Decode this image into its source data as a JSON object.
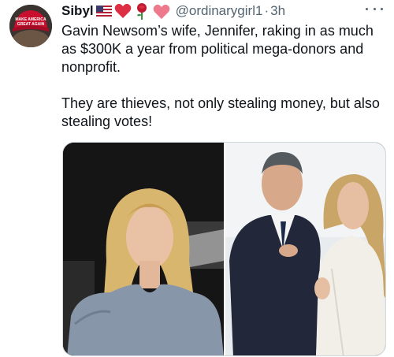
{
  "tweet": {
    "display_name": "Sibyl",
    "handle": "@ordinarygirl1",
    "separator": "·",
    "time": "3h",
    "paragraphs": [
      "Gavin Newsom’s wife, Jennifer, raking in as much as $300K a year from political mega-donors and nonprofit.",
      "They are thieves, not only stealing money, but also stealing votes!"
    ],
    "name_emojis": [
      "us-flag-icon",
      "red-heart-icon",
      "rose-icon",
      "sparkling-heart-icon"
    ],
    "avatar_hat_text": "MAKE AMERICA GREAT AGAIN"
  },
  "colors": {
    "text": "#0f1419",
    "secondary": "#536471",
    "border": "#cfd9de",
    "hat_red": "#c8102e"
  },
  "media": {
    "images": [
      "woman-in-gray-dress-photo",
      "couple-photo"
    ]
  }
}
